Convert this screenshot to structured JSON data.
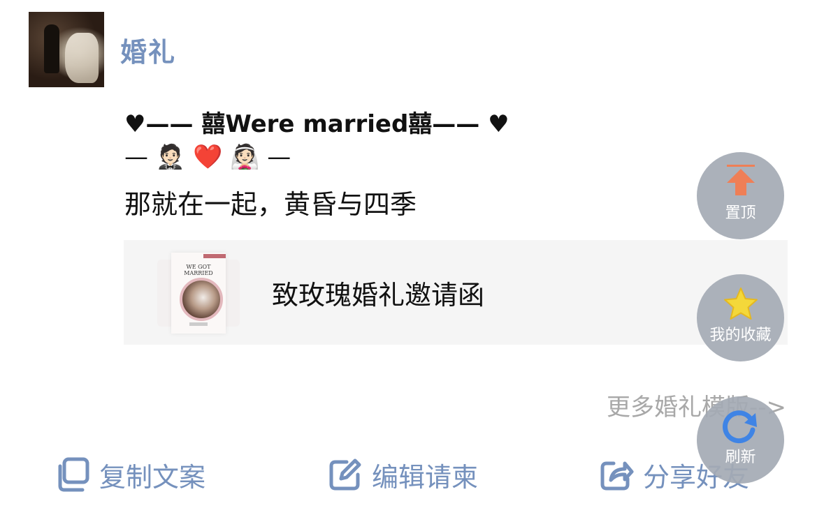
{
  "group": {
    "name": "婚礼"
  },
  "message": {
    "line1": "♥—— 囍Were married囍—— ♥",
    "line2": "— 🤵🏻 ❤️ 👰🏻 —",
    "line3": "那就在一起，黄昏与四季"
  },
  "card": {
    "title": "致玫瑰婚礼邀请函",
    "thumb_text": "WE GOT MARRIED"
  },
  "more_link": "更多婚礼模版-->",
  "actions": {
    "copy": "复制文案",
    "edit": "编辑请柬",
    "share": "分享好友"
  },
  "floating": {
    "top": "置顶",
    "favorites": "我的收藏",
    "refresh": "刷新"
  },
  "colors": {
    "accent": "#7591bd",
    "fab_bg": "#a4aab4",
    "card_bg": "#f5f5f5",
    "muted_text": "#a8a8a8",
    "arrow_orange": "#ef7f56",
    "star_yellow": "#f4d83a",
    "refresh_blue": "#3f84e5"
  }
}
